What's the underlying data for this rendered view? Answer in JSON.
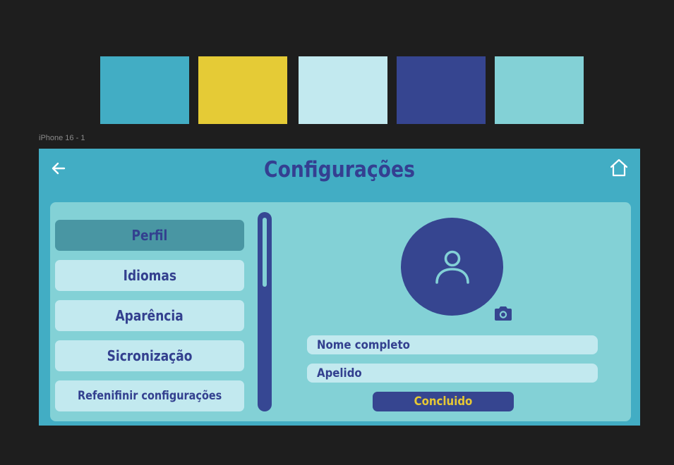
{
  "palette": {
    "colors": [
      "#42adc4",
      "#e5cb36",
      "#c2e9ef",
      "#364590",
      "#83d1d6"
    ]
  },
  "frame": {
    "label": "iPhone 16 - 1"
  },
  "header": {
    "title": "Configurações",
    "back_icon": "arrow-left-icon",
    "home_icon": "home-icon"
  },
  "sidebar": {
    "items": [
      {
        "label": "Perfil",
        "active": true
      },
      {
        "label": "Idiomas",
        "active": false
      },
      {
        "label": "Aparência",
        "active": false
      },
      {
        "label": "Sicronização",
        "active": false
      },
      {
        "label": "Refenifinir configurações",
        "active": false
      }
    ]
  },
  "profile": {
    "avatar_icon": "user-icon",
    "camera_icon": "camera-icon",
    "fields": {
      "full_name_placeholder": "Nome completo",
      "nickname_placeholder": "Apelido"
    },
    "done_label": "Concluido"
  },
  "theme": {
    "background": "#1e1e1e",
    "primary": "#42adc4",
    "panel": "#83d1d6",
    "light": "#c2e9ef",
    "dark": "#364590",
    "accent": "#e5cb36",
    "active_item": "#4996a3"
  }
}
